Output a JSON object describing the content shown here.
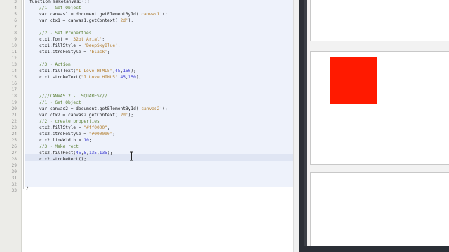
{
  "editor": {
    "lines": [
      {
        "n": "3",
        "parts": [
          [
            "default",
            "function makeCanvas3(){"
          ]
        ]
      },
      {
        "n": "4",
        "parts": [
          [
            "comment",
            "//1 - Get Object"
          ]
        ]
      },
      {
        "n": "5",
        "parts": [
          [
            "default",
            "var canvas1 = document.getElementById("
          ],
          [
            "string",
            "'canvas1'"
          ],
          [
            "default",
            ");"
          ]
        ]
      },
      {
        "n": "6",
        "parts": [
          [
            "default",
            "var ctx1 = canvas1.getContext("
          ],
          [
            "string",
            "'2d'"
          ],
          [
            "default",
            ");"
          ]
        ]
      },
      {
        "n": "7",
        "parts": []
      },
      {
        "n": "8",
        "parts": [
          [
            "comment",
            "//2 - Set Properties"
          ]
        ]
      },
      {
        "n": "9",
        "parts": [
          [
            "default",
            "ctx1.font = "
          ],
          [
            "string",
            "'32pt Arial'"
          ],
          [
            "default",
            ";"
          ]
        ]
      },
      {
        "n": "10",
        "parts": [
          [
            "default",
            "ctx1.fillStyle = "
          ],
          [
            "string",
            "'DeepSkyBlue'"
          ],
          [
            "default",
            ";"
          ]
        ]
      },
      {
        "n": "11",
        "parts": [
          [
            "default",
            "ctx1.strokeStyle = "
          ],
          [
            "string",
            "'black'"
          ],
          [
            "default",
            ";"
          ]
        ]
      },
      {
        "n": "12",
        "parts": []
      },
      {
        "n": "13",
        "parts": [
          [
            "comment",
            "//3 - Action"
          ]
        ]
      },
      {
        "n": "14",
        "parts": [
          [
            "default",
            "ctx1.fillText("
          ],
          [
            "string",
            "\"I Love HTML5\""
          ],
          [
            "default",
            ","
          ],
          [
            "number",
            "45"
          ],
          [
            "default",
            ","
          ],
          [
            "number",
            "150"
          ],
          [
            "default",
            ");"
          ]
        ]
      },
      {
        "n": "15",
        "parts": [
          [
            "default",
            "ctx1.strokeText("
          ],
          [
            "string",
            "\"I Love HTML5\""
          ],
          [
            "default",
            ","
          ],
          [
            "number",
            "45"
          ],
          [
            "default",
            ","
          ],
          [
            "number",
            "150"
          ],
          [
            "default",
            ");"
          ]
        ]
      },
      {
        "n": "16",
        "parts": []
      },
      {
        "n": "17",
        "parts": []
      },
      {
        "n": "18",
        "parts": [
          [
            "comment",
            "////CANVAS 2 -  SQUARES///"
          ]
        ]
      },
      {
        "n": "19",
        "parts": [
          [
            "comment",
            "//1 - Get Object"
          ]
        ]
      },
      {
        "n": "20",
        "parts": [
          [
            "default",
            "var canvas2 = document.getElementById("
          ],
          [
            "string",
            "'canvas2'"
          ],
          [
            "default",
            ");"
          ]
        ]
      },
      {
        "n": "21",
        "parts": [
          [
            "default",
            "var ctx2 = canvas2.getContext("
          ],
          [
            "string",
            "'2d'"
          ],
          [
            "default",
            ");"
          ]
        ]
      },
      {
        "n": "22",
        "parts": [
          [
            "comment",
            "//2 - create properties"
          ]
        ]
      },
      {
        "n": "23",
        "parts": [
          [
            "default",
            "ctx2.fillStyle = "
          ],
          [
            "string",
            "\"#ff0000\""
          ],
          [
            "default",
            ";"
          ]
        ]
      },
      {
        "n": "24",
        "parts": [
          [
            "default",
            "ctx2.strokeStyle = "
          ],
          [
            "string",
            "\"#000000\""
          ],
          [
            "default",
            ";"
          ]
        ]
      },
      {
        "n": "25",
        "parts": [
          [
            "default",
            "ctx2.lineWidth = "
          ],
          [
            "number",
            "10"
          ],
          [
            "default",
            ";"
          ]
        ]
      },
      {
        "n": "26",
        "parts": [
          [
            "comment",
            "//3 - Make rect"
          ]
        ]
      },
      {
        "n": "27",
        "parts": [
          [
            "default",
            "ctx2.fillRect("
          ],
          [
            "number",
            "45"
          ],
          [
            "default",
            ","
          ],
          [
            "number",
            "5"
          ],
          [
            "default",
            ","
          ],
          [
            "number",
            "135"
          ],
          [
            "default",
            ","
          ],
          [
            "number",
            "135"
          ],
          [
            "default",
            ");"
          ]
        ]
      },
      {
        "n": "28",
        "parts": [
          [
            "default",
            "ctx2.strokeRect();"
          ]
        ]
      },
      {
        "n": "29",
        "parts": []
      },
      {
        "n": "30",
        "parts": []
      },
      {
        "n": "31",
        "parts": []
      },
      {
        "n": "32",
        "parts": []
      },
      {
        "n": "33",
        "parts": []
      }
    ],
    "closing_brace": "}",
    "cursor_icon": "text-cursor-icon"
  },
  "preview": {
    "square_color": "#ff1a00"
  },
  "colors": {
    "comment": "#5a7f33",
    "string": "#b07a26",
    "number": "#3a3ad0"
  }
}
